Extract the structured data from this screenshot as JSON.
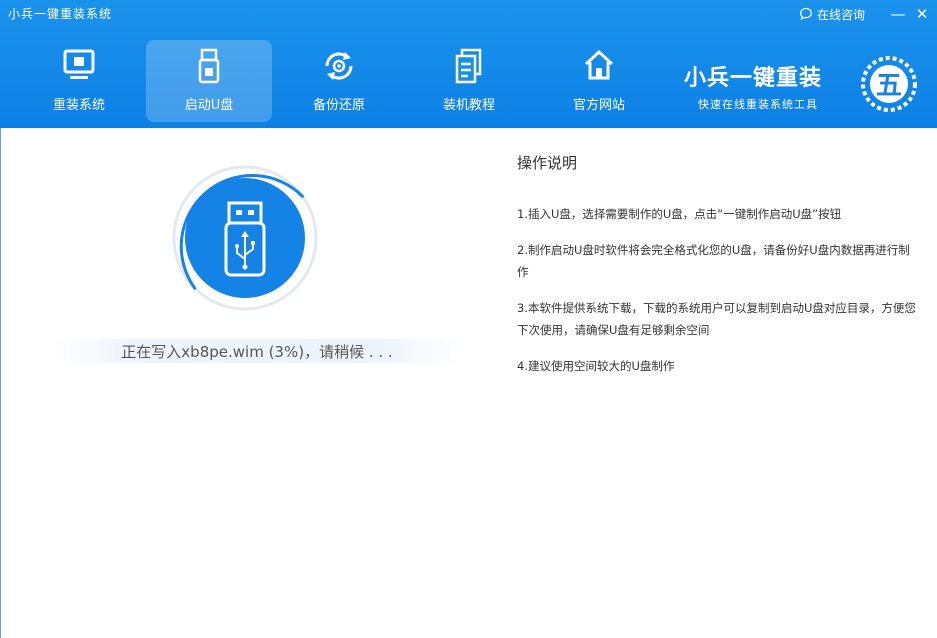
{
  "window": {
    "title": "小兵一键重装系统",
    "consult_label": "在线咨询",
    "minimize_glyph": "—",
    "close_glyph": "✕"
  },
  "nav": [
    {
      "label": "重装系统",
      "icon": "monitor-icon"
    },
    {
      "label": "启动U盘",
      "icon": "usb-drive-icon",
      "active": true
    },
    {
      "label": "备份还原",
      "icon": "backup-restore-icon"
    },
    {
      "label": "装机教程",
      "icon": "document-icon"
    },
    {
      "label": "官方网站",
      "icon": "home-icon"
    }
  ],
  "brand": {
    "name": "小兵一键重装",
    "slogan": "快速在线重装系统工具",
    "logo_text": "五"
  },
  "progress": {
    "percent": 3,
    "status": "正在写入xb8pe.wim (3%)，请稍候 . . ."
  },
  "instructions": {
    "title": "操作说明",
    "items": [
      "1.插入U盘，选择需要制作的U盘，点击“一键制作启动U盘”按钮",
      "2.制作启动U盘时软件将会完全格式化您的U盘，请备份好U盘内数据再进行制作",
      "3.本软件提供系统下载，下载的系统用户可以复制到启动U盘对应目录，方便您下次使用，请确保U盘有足够剩余空间",
      "4.建议使用空间较大的U盘制作"
    ]
  },
  "colors": {
    "header": "#1b8fea",
    "accent": "#1582e6",
    "active_tab": "#54a9f0"
  }
}
